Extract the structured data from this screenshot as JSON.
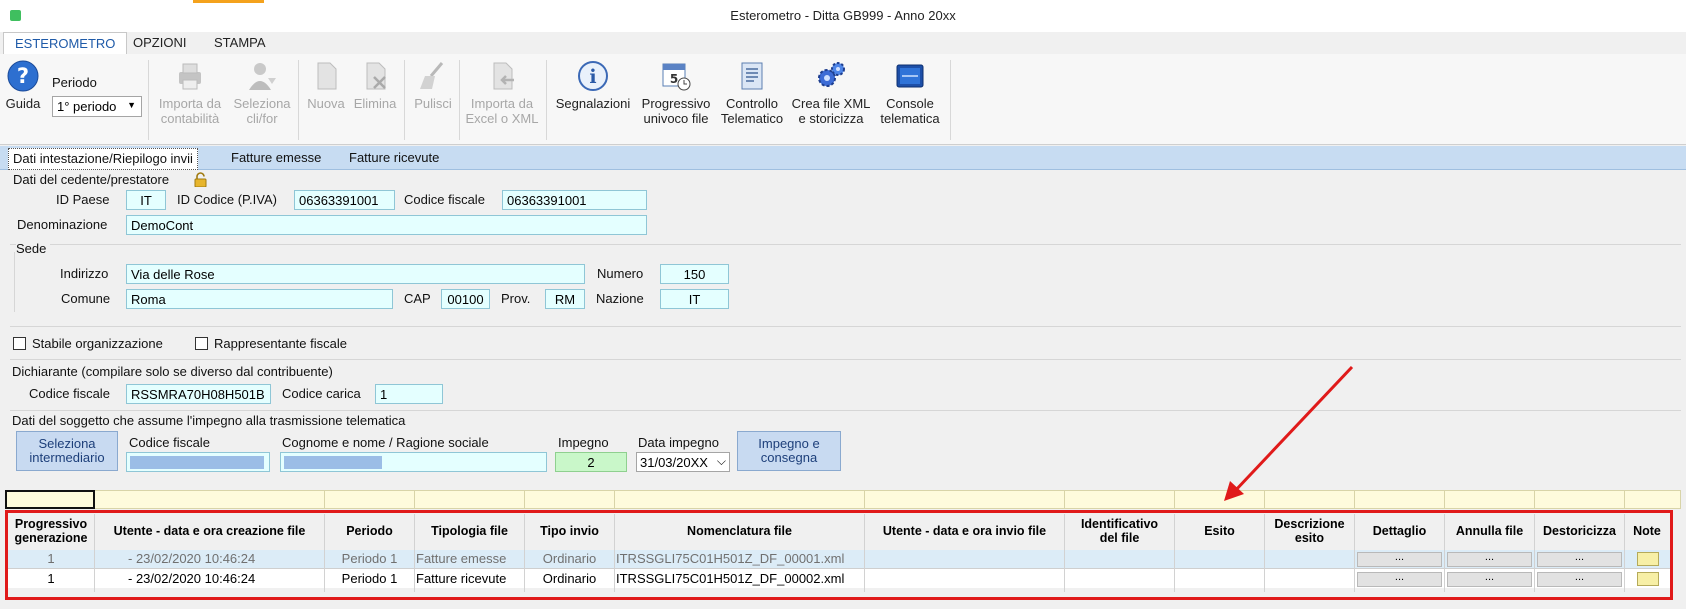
{
  "window": {
    "title": "Esterometro - Ditta GB999 - Anno 20xx"
  },
  "menu_tabs": [
    "ESTEROMETRO",
    "OPZIONI",
    "STAMPA"
  ],
  "ribbon": {
    "guida": "Guida",
    "periodo_label": "Periodo",
    "periodo_value": "1° periodo",
    "importa_contabilita": [
      "Importa da",
      "contabilità"
    ],
    "seleziona_clifor": [
      "Seleziona",
      "cli/for"
    ],
    "nuova": "Nuova",
    "elimina": "Elimina",
    "pulisci": "Pulisci",
    "importa_excel": [
      "Importa da",
      "Excel o XML"
    ],
    "segnalazioni": "Segnalazioni",
    "progressivo": [
      "Progressivo",
      "univoco file"
    ],
    "controllo": [
      "Controllo",
      "Telematico"
    ],
    "crea_xml": [
      "Crea file XML",
      "e storicizza"
    ],
    "console": [
      "Console",
      "telematica"
    ]
  },
  "sub_tabs": [
    "Dati intestazione/Riepilogo invii",
    "Fatture emesse",
    "Fatture ricevute"
  ],
  "cedente": {
    "section_title": "Dati del cedente/prestatore",
    "id_paese_label": "ID Paese",
    "id_paese": "IT",
    "id_codice_label": "ID Codice (P.IVA)",
    "id_codice": "06363391001",
    "codice_fiscale_label": "Codice fiscale",
    "codice_fiscale": "06363391001",
    "denominazione_label": "Denominazione",
    "denominazione": "DemoCont"
  },
  "sede": {
    "section_title": "Sede",
    "indirizzo_label": "Indirizzo",
    "indirizzo": "Via delle Rose",
    "numero_label": "Numero",
    "numero": "150",
    "comune_label": "Comune",
    "comune": "Roma",
    "cap_label": "CAP",
    "cap": "00100",
    "prov_label": "Prov.",
    "prov": "RM",
    "nazione_label": "Nazione",
    "nazione": "IT"
  },
  "checkboxes": {
    "stabile": "Stabile organizzazione",
    "rappresentante": "Rappresentante fiscale"
  },
  "dichiarante": {
    "section_title": "Dichiarante (compilare solo se diverso dal contribuente)",
    "codice_fiscale_label": "Codice fiscale",
    "codice_fiscale": "RSSMRA70H08H501B",
    "codice_carica_label": "Codice carica",
    "codice_carica": "1"
  },
  "trasmissione": {
    "section_title": "Dati del soggetto che assume l'impegno alla trasmissione telematica",
    "seleziona_btn": [
      "Seleziona",
      "intermediario"
    ],
    "codice_fiscale_label": "Codice fiscale",
    "cognome_label": "Cognome e nome / Ragione sociale",
    "impegno_label": "Impegno",
    "impegno": "2",
    "data_impegno_label": "Data impegno",
    "data_impegno": "31/03/20XX",
    "impegno_btn": [
      "Impegno e",
      "consegna"
    ]
  },
  "grid": {
    "headers": [
      [
        "Progressivo",
        "generazione"
      ],
      [
        "Utente - data e ora creazione file"
      ],
      [
        "Periodo"
      ],
      [
        "Tipologia file"
      ],
      [
        "Tipo invio"
      ],
      [
        "Nomenclatura file"
      ],
      [
        "Utente - data e ora invio file"
      ],
      [
        "Identificativo",
        "del file"
      ],
      [
        "Esito"
      ],
      [
        "Descrizione",
        "esito"
      ],
      [
        "Dettaglio"
      ],
      [
        "Annulla file"
      ],
      [
        "Destoricizza"
      ],
      [
        "Note"
      ]
    ],
    "rows": [
      {
        "progressivo": "1",
        "utente": "- 23/02/2020 10:46:24",
        "periodo": "Periodo 1",
        "tipologia": "Fatture emesse",
        "tipo_invio": "Ordinario",
        "nomenclatura": "ITRSSGLI75C01H501Z_DF_00001.xml",
        "btn": "..."
      },
      {
        "progressivo": "1",
        "utente": "- 23/02/2020 10:46:24",
        "periodo": "Periodo 1",
        "tipologia": "Fatture ricevute",
        "tipo_invio": "Ordinario",
        "nomenclatura": "ITRSSGLI75C01H501Z_DF_00002.xml",
        "btn": "..."
      }
    ]
  },
  "colors": {
    "highlight_red": "#e01a1a",
    "field_bg": "#e4ffff",
    "tab_blue": "#c7dcf2"
  }
}
